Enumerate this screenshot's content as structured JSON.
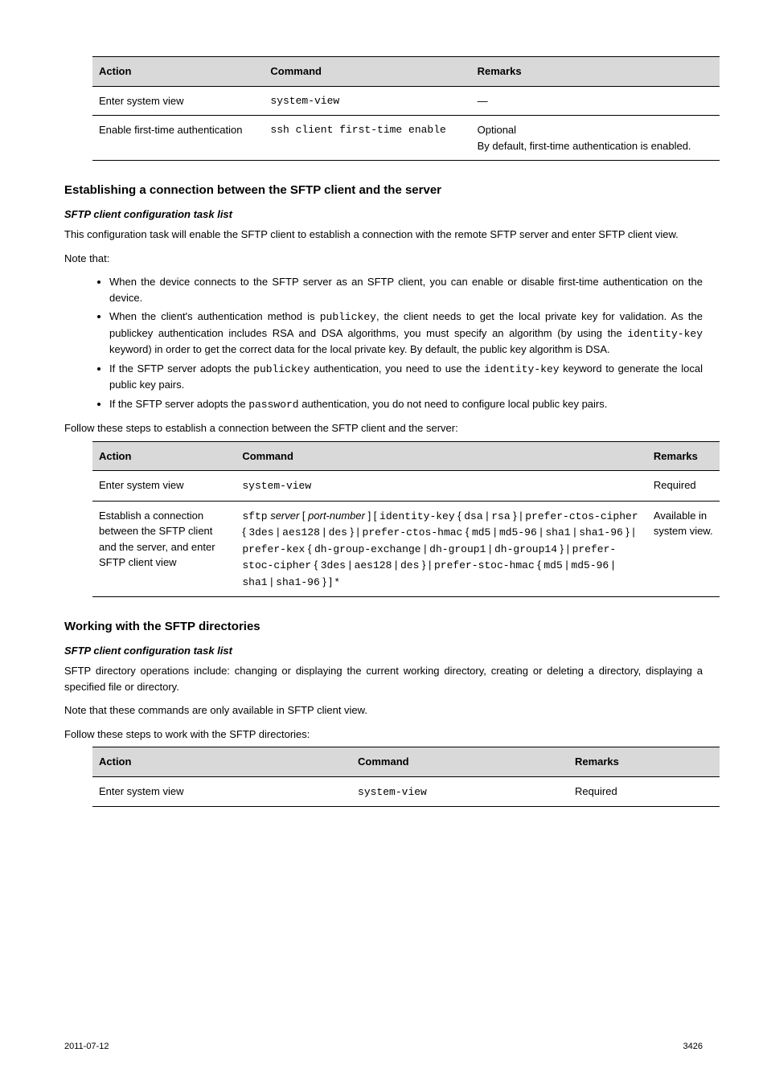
{
  "table1": {
    "headers": [
      "Action",
      "Command",
      "Remarks"
    ],
    "rows": [
      {
        "action": "Enter system view",
        "command": "system-view",
        "remarks": "—"
      },
      {
        "action": "Enable first-time authentication",
        "command": "ssh client first-time enable",
        "remarks": "Optional\nBy default, first-time authentication is enabled."
      }
    ]
  },
  "section1": {
    "title": "Establishing a connection between the SFTP client and the server",
    "lead": "SFTP client configuration task list",
    "para": "This configuration task will enable the SFTP client to establish a connection with the remote SFTP server and enter SFTP client view.",
    "notes_title": "Note that:",
    "bullets": [
      "When the device connects to the SFTP server as an SFTP client, you can enable or disable first-time authentication on the device.",
      "When the client's authentication method is <span class='mono'>publickey</span>, the client needs to get the local private key for validation. As the publickey authentication includes RSA and DSA algorithms, you must specify an algorithm (by using the <span class='mono'>identity-key</span> keyword) in order to get the correct data for the local private key. By default, the public key algorithm is DSA.",
      "If the SFTP server adopts the <span class='mono'>publickey</span> authentication, you need to use the <span class='mono'>identity-key</span> keyword to generate the local public key pairs.",
      "If the SFTP server adopts the <span class='mono'>password</span> authentication, you do not need to configure local public key pairs."
    ]
  },
  "table2": {
    "caption": "Follow these steps to establish a connection between the SFTP client and the server:",
    "headers": [
      "Action",
      "Command",
      "Remarks"
    ],
    "rows": [
      {
        "action": "Enter system view",
        "command": "<span class='mono'>system-view</span>",
        "remarks": "Required"
      },
      {
        "action": "Establish a connection between the SFTP client and the server, and enter SFTP client view",
        "command": "<span class='mono'>sftp</span> <span class='italic'>server</span> [ <span class='italic'>port-number</span> ] [ <span class='mono'>identity-key</span> { <span class='mono'>dsa</span> | <span class='mono'>rsa</span> } | <span class='mono'>prefer-ctos-cipher</span> { <span class='mono'>3des</span> | <span class='mono'>aes128</span> | <span class='mono'>des</span> } | <span class='mono'>prefer-ctos-hmac</span> { <span class='mono'>md5</span> | <span class='mono'>md5-96</span> | <span class='mono'>sha1</span> | <span class='mono'>sha1-96</span> } | <span class='mono'>prefer-kex</span> { <span class='mono'>dh-group-exchange</span> | <span class='mono'>dh-group1</span> | <span class='mono'>dh-group14</span> } | <span class='mono'>prefer-stoc-cipher</span> { <span class='mono'>3des</span> | <span class='mono'>aes128</span> | <span class='mono'>des</span> } | <span class='mono'>prefer-stoc-hmac</span> { <span class='mono'>md5</span> | <span class='mono'>md5-96</span> | <span class='mono'>sha1</span> | <span class='mono'>sha1-96</span> } ] *",
        "remarks": "Available in system view."
      }
    ]
  },
  "section2": {
    "title": "Working with the SFTP directories",
    "lead": "SFTP client configuration task list",
    "para1": "SFTP directory operations include: changing or displaying the current working directory, creating or deleting a directory, displaying a specified file or directory.",
    "para2": "Note that these commands are only available in SFTP client view.",
    "caption": "Follow these steps to work with the SFTP directories:"
  },
  "table3": {
    "headers": [
      "Action",
      "Command",
      "Remarks"
    ],
    "rows": [
      {
        "action": "Enter system view",
        "command": "<span class='mono'>system-view</span>",
        "remarks": "Required"
      }
    ]
  },
  "footer": {
    "left": "2011-07-12",
    "right": "3426"
  }
}
